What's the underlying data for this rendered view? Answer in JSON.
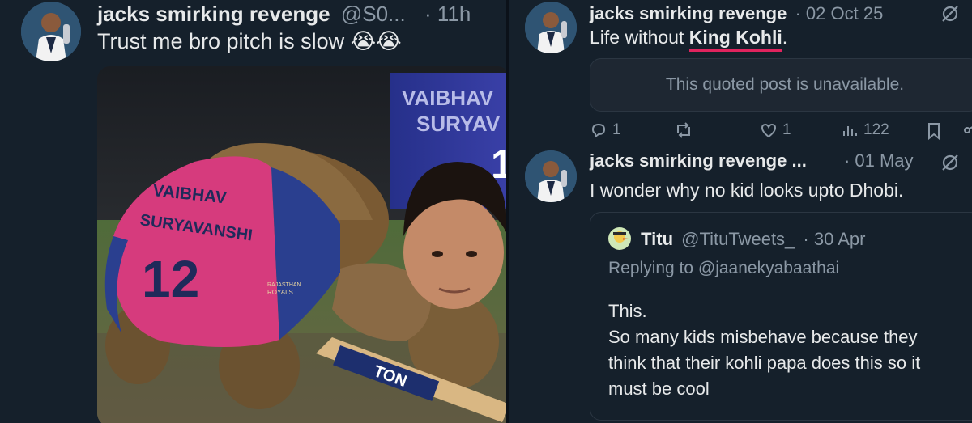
{
  "left_tweet": {
    "author_name": "jacks smirking revenge",
    "handle": "@S0...",
    "time": "· 11h",
    "text": "Trust me bro pitch is slow 😭😭",
    "media": {
      "banner_line1": "VAIBHAV",
      "banner_line2": "SURYAV",
      "banner_number": "1",
      "jersey_line1": "VAIBHAV",
      "jersey_line2": "SURYAVANSHI",
      "jersey_number": "12",
      "jersey_team_line1": "RAJASTHAN",
      "jersey_team_line2": "ROYALS",
      "bat_text": "TON"
    }
  },
  "right_tweets": [
    {
      "author_name": "jacks smirking revenge",
      "time": "· 02 Oct 25",
      "text_prefix": "Life without ",
      "text_highlight": "King Kohli",
      "text_suffix": ".",
      "quoted_unavailable": "This quoted post is unavailable.",
      "actions": {
        "replies": "1",
        "reposts": "",
        "likes": "1",
        "views": "122"
      }
    },
    {
      "author_name": "jacks smirking revenge ...",
      "time": "· 01 May",
      "text": "I wonder why no kid looks upto Dhobi.",
      "quote": {
        "author_name": "Titu",
        "handle": "@TituTweets_",
        "time": "· 30 Apr",
        "replying_to": "Replying to @jaanekyabaathai",
        "lines": [
          "This.",
          "So many kids misbehave because they",
          "think that their kohli papa does this so it",
          "must be cool"
        ]
      }
    }
  ],
  "colors": {
    "background": "#15202b",
    "text": "#e7e9ea",
    "muted": "#8b98a5",
    "underline": "#e0245e",
    "jersey_pink": "#d63b7d",
    "jersey_blue": "#2a3f8f"
  },
  "icons": [
    "grok-icon",
    "reply-icon",
    "repost-icon",
    "like-icon",
    "views-icon",
    "bookmark-icon",
    "share-icon"
  ]
}
